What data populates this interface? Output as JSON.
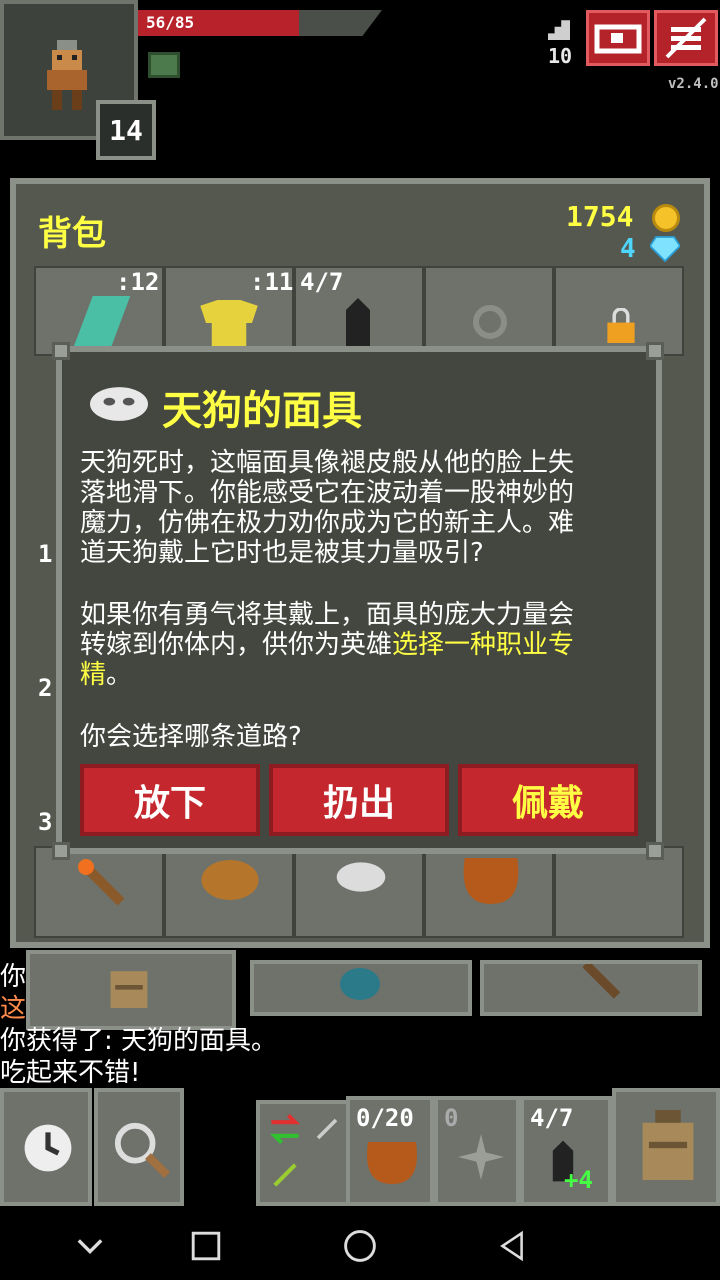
{
  "status": {
    "hp_text": "56/85",
    "hp_fraction": 0.66,
    "hero_level": "14",
    "depth": "10",
    "version": "v2.4.0"
  },
  "inventory": {
    "title": "背包",
    "gold": "1754",
    "energy": "4",
    "top_row_qty": [
      ":12",
      ":11",
      "4/7"
    ],
    "left_row_numbers": [
      "1",
      "2",
      "3"
    ]
  },
  "dialog": {
    "title": "天狗的面具",
    "para1_lines": [
      "天狗死时，这幅面具像褪皮般从他的脸上失",
      "落地滑下。你能感受它在波动着一股神妙的",
      "魔力，仿佛在极力劝你成为它的新主人。难",
      "道天狗戴上它时也是被其力量吸引?"
    ],
    "para2_line1": "如果你有勇气将其戴上，面具的庞大力量会",
    "para2_line2_pre": "转嫁到你体内，供你为英雄",
    "para2_line2_hl": "选择一种职业专",
    "para2_line3_hl": "精",
    "para2_line3_post": "。",
    "question": "你会选择哪条道路?",
    "buttons": {
      "drop": "放下",
      "throw": "扔出",
      "equip": "佩戴"
    }
  },
  "log": {
    "line1": "你",
    "line2": "这",
    "line3": "你获得了: 天狗的面具。",
    "line4": "吃起来不错!"
  },
  "toolbar": {
    "quickslot_qty": "0/20",
    "quickslot2_qty": "0",
    "quickslot3_qty": "4/7",
    "quickslot3_bonus": "+4"
  },
  "colors": {
    "accent_yellow": "#ffff44",
    "button_red": "#c4282e",
    "hp_red": "#b8232b"
  }
}
